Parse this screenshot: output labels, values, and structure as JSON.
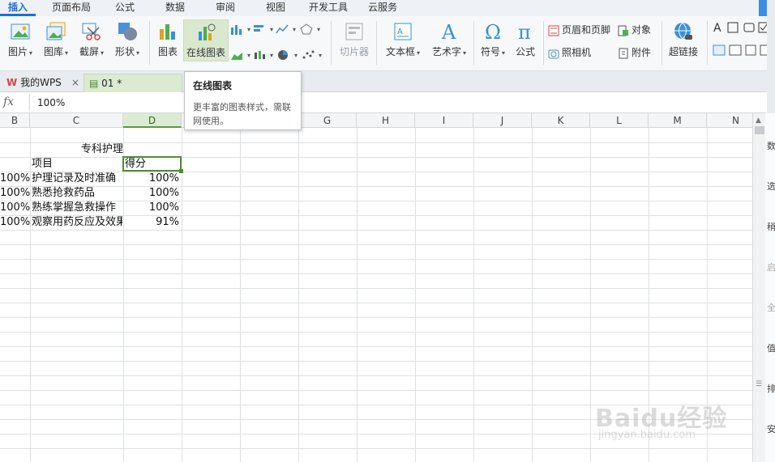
{
  "menu": {
    "tabs": [
      "插入",
      "页面布局",
      "公式",
      "数据",
      "审阅",
      "视图",
      "开发工具",
      "云服务"
    ],
    "active": "插入"
  },
  "ribbon": {
    "picture": "图片",
    "gallery": "图库",
    "screenshot": "截屏",
    "shapes": "形状",
    "chart": "图表",
    "online_chart": "在线图表",
    "slicer": "切片器",
    "textbox": "文本框",
    "wordart": "艺术字",
    "symbol": "符号",
    "formula": "公式",
    "header_footer": "页眉和页脚",
    "object": "对象",
    "camera": "照相机",
    "attachment": "附件",
    "hyperlink": "超链接",
    "dropdown_arrow": "▾"
  },
  "doc_tabs": {
    "wps": "我的WPS",
    "close": "×",
    "file": "01 *"
  },
  "formula_bar": {
    "fx": "fx",
    "value": "100%"
  },
  "columns": [
    "B",
    "C",
    "D",
    "E",
    "F",
    "G",
    "H",
    "I",
    "J",
    "K",
    "L",
    "M",
    "N"
  ],
  "selected_column": "D",
  "sheet": {
    "title": "专科护理",
    "header_item": "项目",
    "header_score": "得分",
    "rows": [
      {
        "b": "100%",
        "item": "护理记录及时准确",
        "score": "100%"
      },
      {
        "b": "100%",
        "item": "熟悉抢救药品",
        "score": "100%"
      },
      {
        "b": "100%",
        "item": "熟练掌握急救操作",
        "score": "100%"
      },
      {
        "b": "100%",
        "item": "观察用药反应及效果",
        "score": "91%"
      }
    ]
  },
  "tooltip": {
    "title": "在线图表",
    "body": "更丰富的图表样式，需联网使用。"
  },
  "right_pane_chars": [
    "数",
    "选",
    "稍",
    "启",
    "全",
    "值",
    "排",
    "安"
  ],
  "scroll": {
    "up": "▲",
    "mid": "☰"
  },
  "watermark": {
    "text": "Baidu经验",
    "sub": "jingyan.baidu.com"
  },
  "colors": {
    "accent": "#1d6fd8",
    "selection": "#4f8f2f"
  }
}
